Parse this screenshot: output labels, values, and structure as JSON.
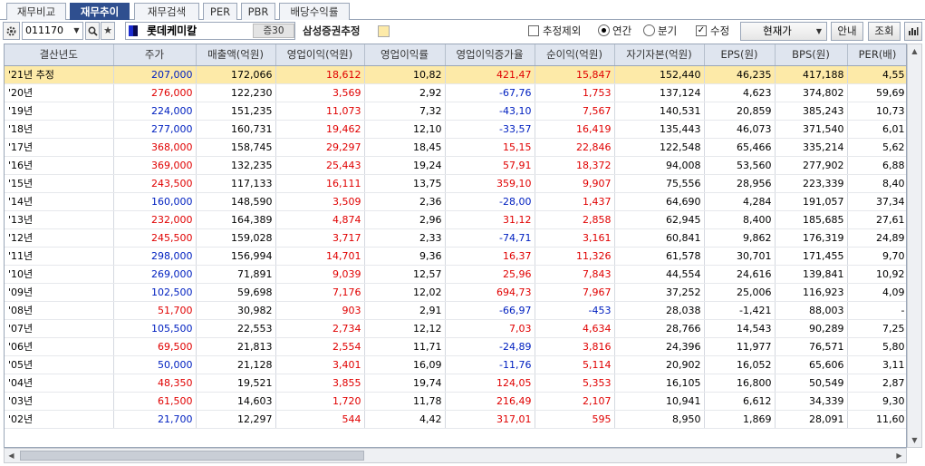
{
  "tabs": [
    {
      "label": "재무비교",
      "active": false
    },
    {
      "label": "재무추이",
      "active": true
    },
    {
      "label": "재무검색",
      "active": false
    },
    {
      "label": "PER",
      "active": false
    },
    {
      "label": "PBR",
      "active": false
    },
    {
      "label": "배당수익률",
      "active": false
    }
  ],
  "toolbar": {
    "stock_code": "011170",
    "stock_name": "롯데케미칼",
    "margin_badge": "증30",
    "estimate_source": "삼성증권추정",
    "exclude_estimate_label": "추정제외",
    "exclude_estimate_checked": false,
    "period_annual_label": "연간",
    "period_quarter_label": "분기",
    "period_selected": "annual",
    "revised_label": "수정",
    "revised_checked": true,
    "price_select_value": "현재가",
    "guide_button": "안내",
    "query_button": "조회",
    "estimate_color": "#fdeaa8"
  },
  "table": {
    "columns": [
      "결산년도",
      "주가",
      "매출액(억원)",
      "영업이익(억원)",
      "영업이익률",
      "영업이익증가율",
      "순이익(억원)",
      "자기자본(억원)",
      "EPS(원)",
      "BPS(원)",
      "PER(배)"
    ],
    "rows": [
      {
        "year": "'21년 추정",
        "price": "207,000",
        "price_c": "blue",
        "sales": "172,066",
        "op": "18,612",
        "op_c": "red",
        "margin": "10,82",
        "growth": "421,47",
        "growth_c": "red",
        "net": "15,847",
        "net_c": "red",
        "equity": "152,440",
        "eps": "46,235",
        "bps": "417,188",
        "per": "4,55",
        "estimate": true
      },
      {
        "year": "'20년",
        "price": "276,000",
        "price_c": "red",
        "sales": "122,230",
        "op": "3,569",
        "op_c": "red",
        "margin": "2,92",
        "growth": "-67,76",
        "growth_c": "blue",
        "net": "1,753",
        "net_c": "red",
        "equity": "137,124",
        "eps": "4,623",
        "bps": "374,802",
        "per": "59,69"
      },
      {
        "year": "'19년",
        "price": "224,000",
        "price_c": "blue",
        "sales": "151,235",
        "op": "11,073",
        "op_c": "red",
        "margin": "7,32",
        "growth": "-43,10",
        "growth_c": "blue",
        "net": "7,567",
        "net_c": "red",
        "equity": "140,531",
        "eps": "20,859",
        "bps": "385,243",
        "per": "10,73"
      },
      {
        "year": "'18년",
        "price": "277,000",
        "price_c": "blue",
        "sales": "160,731",
        "op": "19,462",
        "op_c": "red",
        "margin": "12,10",
        "growth": "-33,57",
        "growth_c": "blue",
        "net": "16,419",
        "net_c": "red",
        "equity": "135,443",
        "eps": "46,073",
        "bps": "371,540",
        "per": "6,01"
      },
      {
        "year": "'17년",
        "price": "368,000",
        "price_c": "red",
        "sales": "158,745",
        "op": "29,297",
        "op_c": "red",
        "margin": "18,45",
        "growth": "15,15",
        "growth_c": "red",
        "net": "22,846",
        "net_c": "red",
        "equity": "122,548",
        "eps": "65,466",
        "bps": "335,214",
        "per": "5,62"
      },
      {
        "year": "'16년",
        "price": "369,000",
        "price_c": "red",
        "sales": "132,235",
        "op": "25,443",
        "op_c": "red",
        "margin": "19,24",
        "growth": "57,91",
        "growth_c": "red",
        "net": "18,372",
        "net_c": "red",
        "equity": "94,008",
        "eps": "53,560",
        "bps": "277,902",
        "per": "6,88"
      },
      {
        "year": "'15년",
        "price": "243,500",
        "price_c": "red",
        "sales": "117,133",
        "op": "16,111",
        "op_c": "red",
        "margin": "13,75",
        "growth": "359,10",
        "growth_c": "red",
        "net": "9,907",
        "net_c": "red",
        "equity": "75,556",
        "eps": "28,956",
        "bps": "223,339",
        "per": "8,40"
      },
      {
        "year": "'14년",
        "price": "160,000",
        "price_c": "blue",
        "sales": "148,590",
        "op": "3,509",
        "op_c": "red",
        "margin": "2,36",
        "growth": "-28,00",
        "growth_c": "blue",
        "net": "1,437",
        "net_c": "red",
        "equity": "64,690",
        "eps": "4,284",
        "bps": "191,057",
        "per": "37,34"
      },
      {
        "year": "'13년",
        "price": "232,000",
        "price_c": "red",
        "sales": "164,389",
        "op": "4,874",
        "op_c": "red",
        "margin": "2,96",
        "growth": "31,12",
        "growth_c": "red",
        "net": "2,858",
        "net_c": "red",
        "equity": "62,945",
        "eps": "8,400",
        "bps": "185,685",
        "per": "27,61"
      },
      {
        "year": "'12년",
        "price": "245,500",
        "price_c": "red",
        "sales": "159,028",
        "op": "3,717",
        "op_c": "red",
        "margin": "2,33",
        "growth": "-74,71",
        "growth_c": "blue",
        "net": "3,161",
        "net_c": "red",
        "equity": "60,841",
        "eps": "9,862",
        "bps": "176,319",
        "per": "24,89"
      },
      {
        "year": "'11년",
        "price": "298,000",
        "price_c": "blue",
        "sales": "156,994",
        "op": "14,701",
        "op_c": "red",
        "margin": "9,36",
        "growth": "16,37",
        "growth_c": "red",
        "net": "11,326",
        "net_c": "red",
        "equity": "61,578",
        "eps": "30,701",
        "bps": "171,455",
        "per": "9,70"
      },
      {
        "year": "'10년",
        "price": "269,000",
        "price_c": "blue",
        "sales": "71,891",
        "op": "9,039",
        "op_c": "red",
        "margin": "12,57",
        "growth": "25,96",
        "growth_c": "red",
        "net": "7,843",
        "net_c": "red",
        "equity": "44,554",
        "eps": "24,616",
        "bps": "139,841",
        "per": "10,92"
      },
      {
        "year": "'09년",
        "price": "102,500",
        "price_c": "blue",
        "sales": "59,698",
        "op": "7,176",
        "op_c": "red",
        "margin": "12,02",
        "growth": "694,73",
        "growth_c": "red",
        "net": "7,967",
        "net_c": "red",
        "equity": "37,252",
        "eps": "25,006",
        "bps": "116,923",
        "per": "4,09"
      },
      {
        "year": "'08년",
        "price": "51,700",
        "price_c": "red",
        "sales": "30,982",
        "op": "903",
        "op_c": "red",
        "margin": "2,91",
        "growth": "-66,97",
        "growth_c": "blue",
        "net": "-453",
        "net_c": "blue",
        "equity": "28,038",
        "eps": "-1,421",
        "bps": "88,003",
        "per": "-"
      },
      {
        "year": "'07년",
        "price": "105,500",
        "price_c": "blue",
        "sales": "22,553",
        "op": "2,734",
        "op_c": "red",
        "margin": "12,12",
        "growth": "7,03",
        "growth_c": "red",
        "net": "4,634",
        "net_c": "red",
        "equity": "28,766",
        "eps": "14,543",
        "bps": "90,289",
        "per": "7,25"
      },
      {
        "year": "'06년",
        "price": "69,500",
        "price_c": "red",
        "sales": "21,813",
        "op": "2,554",
        "op_c": "red",
        "margin": "11,71",
        "growth": "-24,89",
        "growth_c": "blue",
        "net": "3,816",
        "net_c": "red",
        "equity": "24,396",
        "eps": "11,977",
        "bps": "76,571",
        "per": "5,80"
      },
      {
        "year": "'05년",
        "price": "50,000",
        "price_c": "blue",
        "sales": "21,128",
        "op": "3,401",
        "op_c": "red",
        "margin": "16,09",
        "growth": "-11,76",
        "growth_c": "blue",
        "net": "5,114",
        "net_c": "red",
        "equity": "20,902",
        "eps": "16,052",
        "bps": "65,606",
        "per": "3,11"
      },
      {
        "year": "'04년",
        "price": "48,350",
        "price_c": "red",
        "sales": "19,521",
        "op": "3,855",
        "op_c": "red",
        "margin": "19,74",
        "growth": "124,05",
        "growth_c": "red",
        "net": "5,353",
        "net_c": "red",
        "equity": "16,105",
        "eps": "16,800",
        "bps": "50,549",
        "per": "2,87"
      },
      {
        "year": "'03년",
        "price": "61,500",
        "price_c": "red",
        "sales": "14,603",
        "op": "1,720",
        "op_c": "red",
        "margin": "11,78",
        "growth": "216,49",
        "growth_c": "red",
        "net": "2,107",
        "net_c": "red",
        "equity": "10,941",
        "eps": "6,612",
        "bps": "34,339",
        "per": "9,30"
      },
      {
        "year": "'02년",
        "price": "21,700",
        "price_c": "blue",
        "sales": "12,297",
        "op": "544",
        "op_c": "red",
        "margin": "4,42",
        "growth": "317,01",
        "growth_c": "red",
        "net": "595",
        "net_c": "red",
        "equity": "8,950",
        "eps": "1,869",
        "bps": "28,091",
        "per": "11,60"
      }
    ]
  },
  "icons": {
    "settings": "gear-icon",
    "search": "search-icon",
    "favorite": "star-icon",
    "chart": "bar-chart-icon"
  }
}
